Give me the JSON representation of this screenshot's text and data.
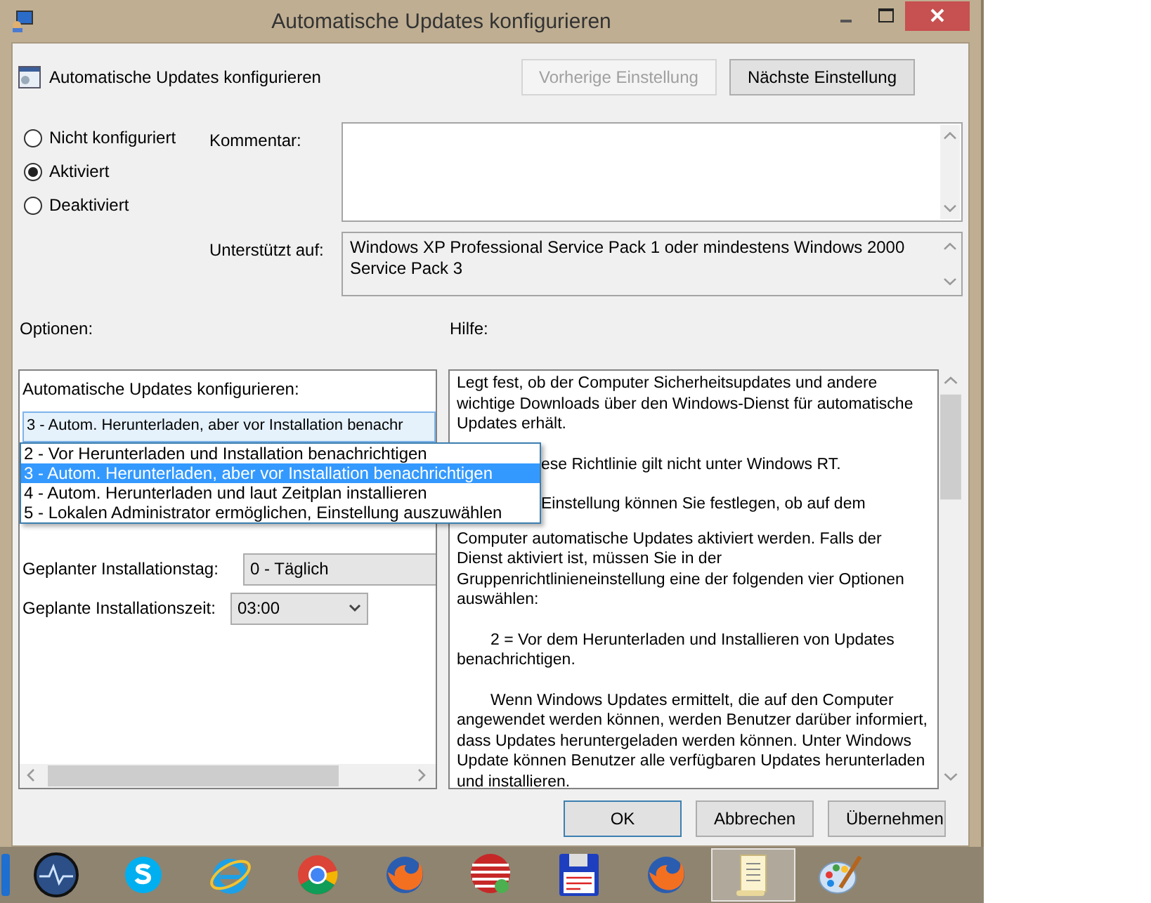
{
  "window": {
    "title": "Automatische Updates konfigurieren"
  },
  "header": {
    "title": "Automatische Updates konfigurieren",
    "buttons": [
      {
        "label": "Vorherige Einstellung",
        "disabled": true
      },
      {
        "label": "Nächste Einstellung",
        "disabled": false
      }
    ]
  },
  "state_options": [
    {
      "label": "Nicht konfiguriert",
      "selected": false
    },
    {
      "label": "Aktiviert",
      "selected": true
    },
    {
      "label": "Deaktiviert",
      "selected": false
    }
  ],
  "comment": {
    "label": "Kommentar:"
  },
  "supported": {
    "label": "Unterstützt auf:",
    "value": "Windows XP Professional Service Pack 1 oder mindestens Windows 2000 Service Pack 3"
  },
  "options": {
    "heading": "Optionen:",
    "mode": {
      "label": "Automatische Updates konfigurieren:",
      "value": "3 - Autom. Herunterladen, aber vor Installation benachr",
      "open": true,
      "list": [
        {
          "label": "2 - Vor Herunterladen und Installation benachrichtigen",
          "selected": false
        },
        {
          "label": "3 - Autom. Herunterladen, aber vor Installation benachrichtigen",
          "selected": true
        },
        {
          "label": "4 - Autom. Herunterladen und laut Zeitplan installieren",
          "selected": false
        },
        {
          "label": "5 - Lokalen Administrator ermöglichen, Einstellung auszuwählen",
          "selected": false
        }
      ]
    },
    "rows": [
      {
        "label": "Geplanter Installationstag:",
        "value": "0 - Täglich",
        "kind": "cut"
      },
      {
        "label": "Geplante Installationszeit:",
        "value": "03:00",
        "kind": "dropdown"
      }
    ]
  },
  "help": {
    "heading": "Hilfe:",
    "paragraphs": [
      {
        "text": "Legt fest, ob der Computer Sicherheitsupdates und andere wichtige Downloads über den Windows-Dienst für automatische Updates erhält.",
        "kind": "text"
      },
      {
        "text": "ese Richtlinie gilt nicht unter Windows RT.",
        "kind": "clipped"
      },
      {
        "text": "Einstellung können Sie festlegen, ob auf dem",
        "kind": "clipped"
      },
      {
        "text": "Computer automatische Updates aktiviert werden. Falls der Dienst aktiviert ist, müssen Sie in der Gruppenrichtlinieneinstellung eine der folgenden vier Optionen auswählen:",
        "kind": "continued"
      },
      {
        "text": "2 = Vor dem Herunterladen und Installieren von Updates benachrichtigen.",
        "kind": "indented"
      },
      {
        "text": "Wenn Windows Updates ermittelt, die auf den Computer angewendet werden können, werden Benutzer darüber informiert, dass Updates heruntergeladen werden können. Unter Windows Update können Benutzer alle verfügbaren Updates herunterladen und installieren.",
        "kind": "indented"
      }
    ]
  },
  "footer_buttons": [
    {
      "label": "OK",
      "focused": true
    },
    {
      "label": "Abbrechen",
      "focused": false
    },
    {
      "label": "Übernehmen",
      "focused": false
    }
  ],
  "taskbar": {
    "items": [
      {
        "kind": "blue-edge",
        "active": false
      },
      {
        "kind": "pulse",
        "active": false
      },
      {
        "kind": "skype",
        "active": false
      },
      {
        "kind": "ie",
        "active": false
      },
      {
        "kind": "chrome",
        "active": false
      },
      {
        "kind": "firefox",
        "active": false
      },
      {
        "kind": "globe",
        "active": false
      },
      {
        "kind": "floppy",
        "active": false
      },
      {
        "kind": "firefox",
        "active": false
      },
      {
        "kind": "scroll",
        "active": true
      },
      {
        "kind": "palette",
        "active": false
      }
    ]
  }
}
